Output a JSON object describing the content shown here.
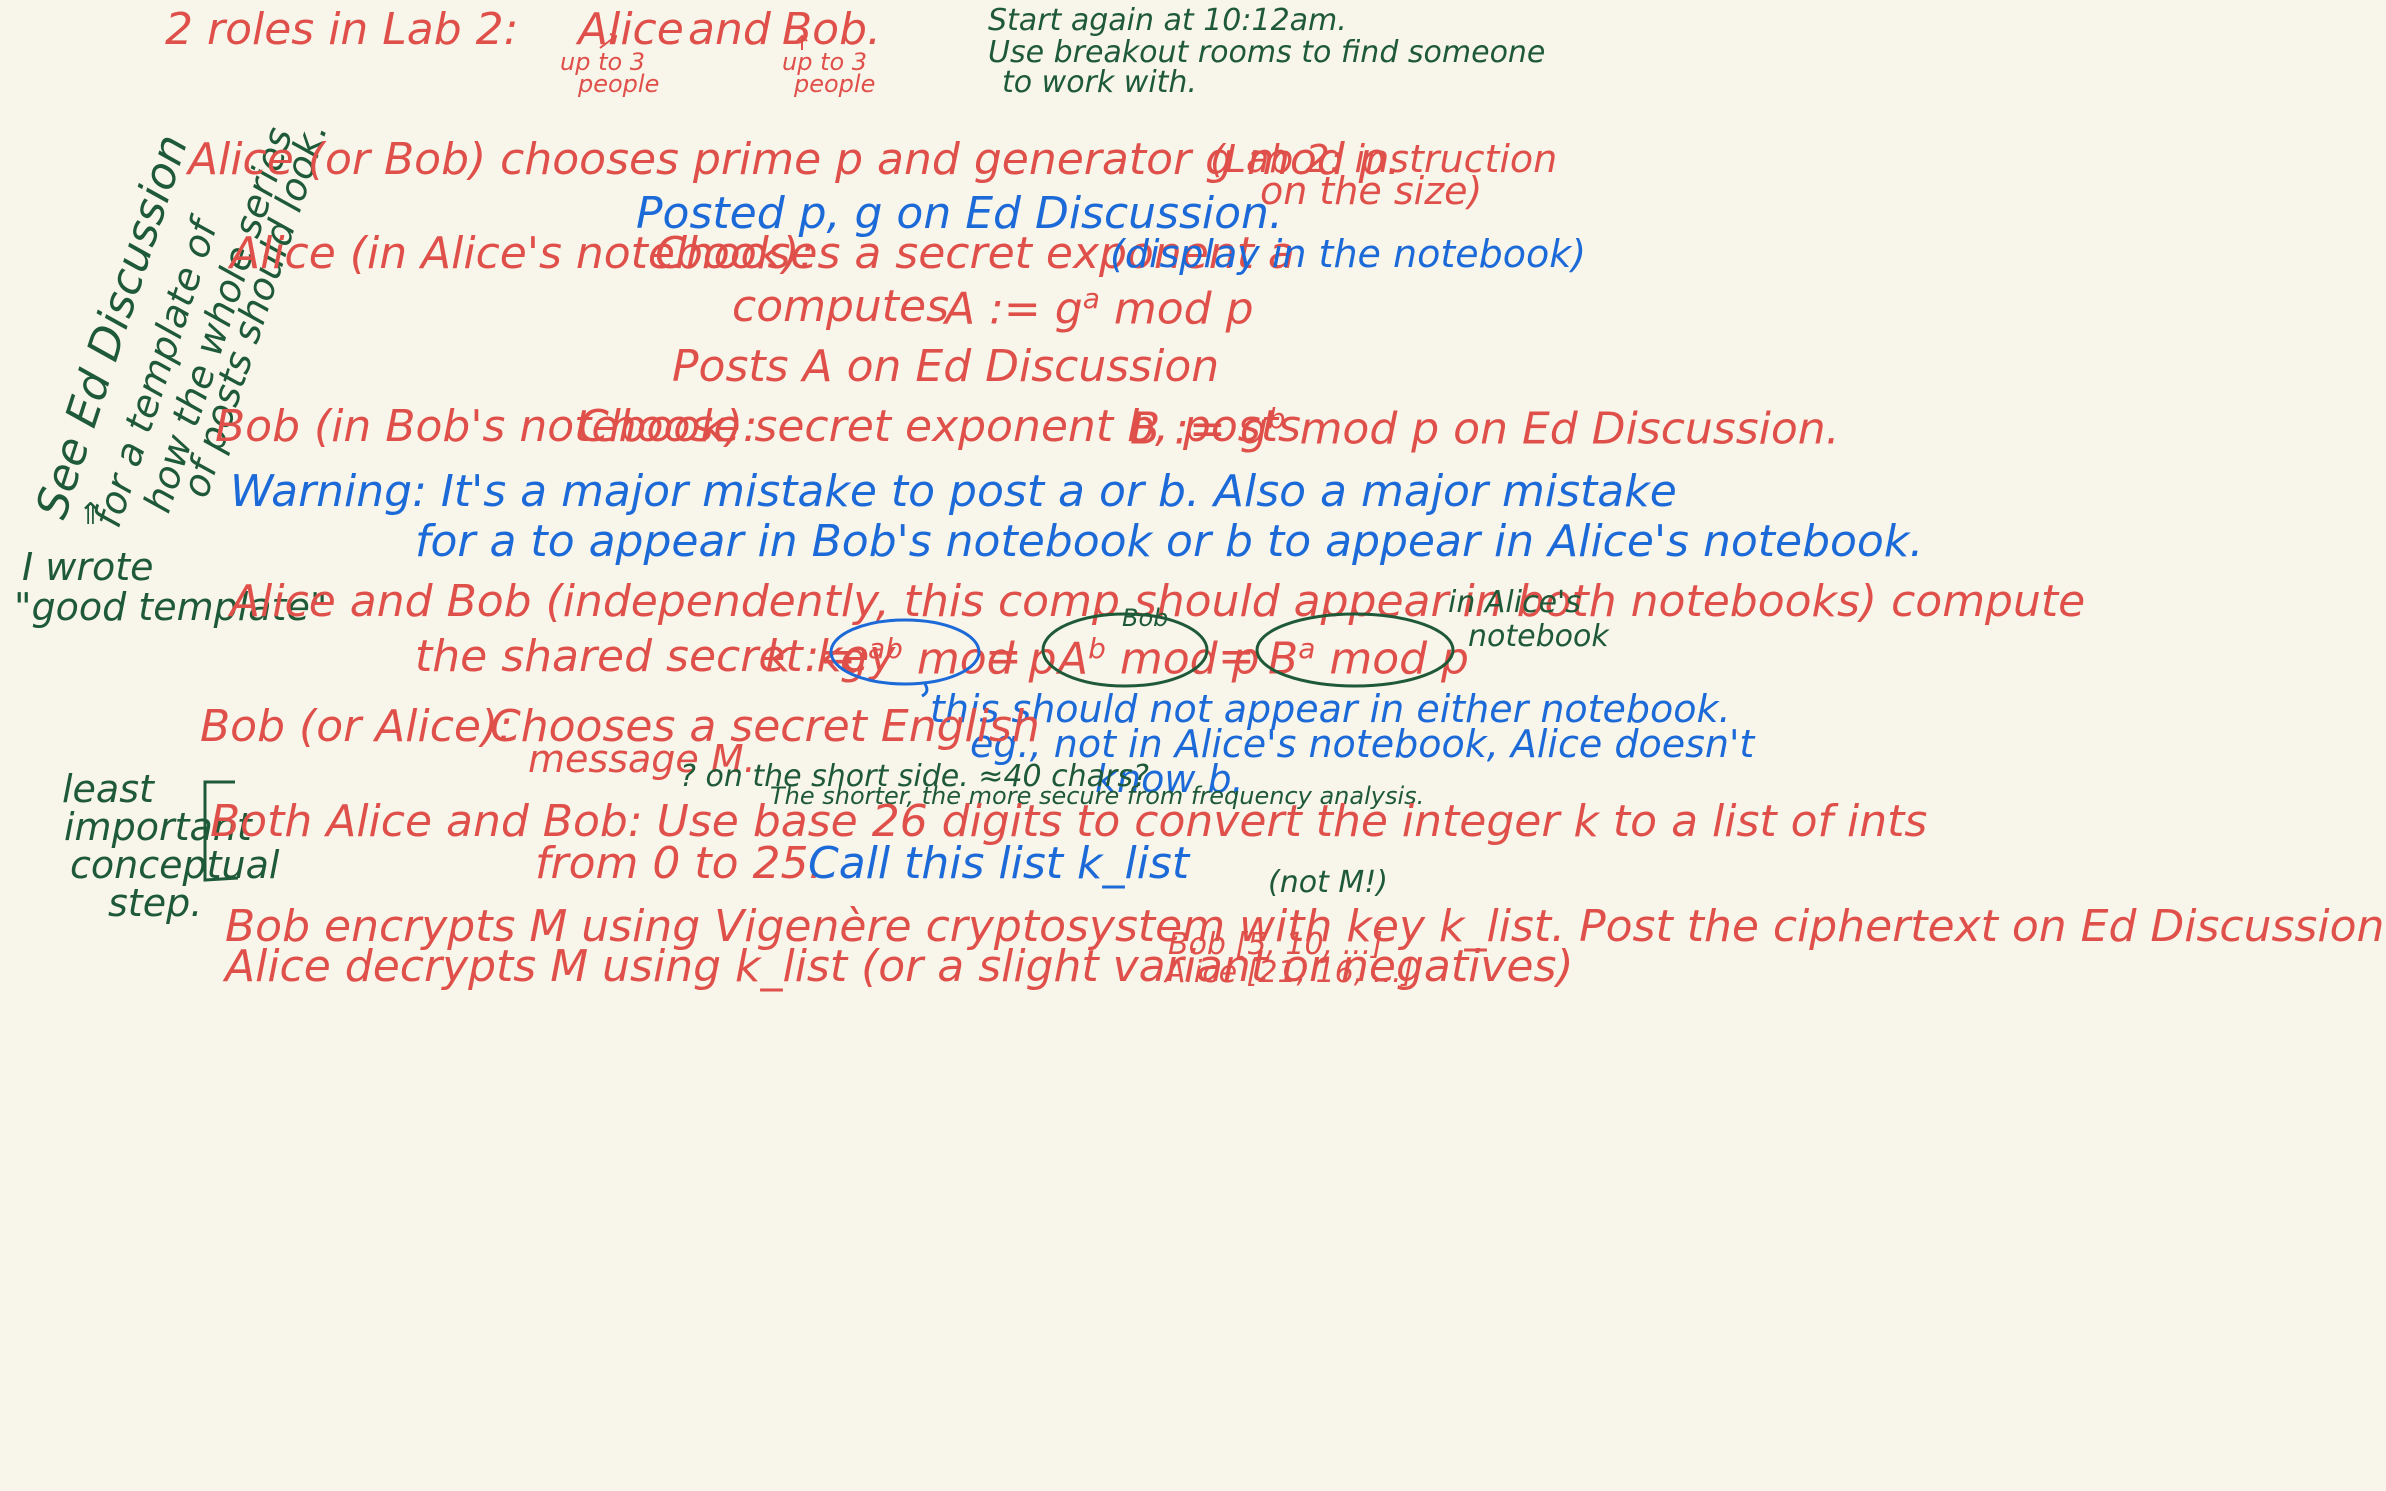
{
  "colors": {
    "background": "#f8f5eb",
    "red": "#e0504a",
    "blue": "#1c6ad8",
    "green": "#1f5a38"
  },
  "header": {
    "roles": "2 roles in Lab 2:",
    "alice": "Alice",
    "and": "and",
    "bob": "Bob.",
    "alice_note_1": "up to 3",
    "alice_note_2": "people",
    "bob_note_1": "up to 3",
    "bob_note_2": "people",
    "restart_1": "Start again at 10:12am.",
    "restart_2": "Use breakout rooms to find someone",
    "restart_3": "to work with."
  },
  "side": {
    "see_1": "See Ed Discussion",
    "see_2": "for a template of",
    "see_3": "how the whole series",
    "see_4": "of posts should look.",
    "wrote_1": "I wrote",
    "wrote_2": "\"good template\"",
    "least_1": "least",
    "least_2": "important",
    "least_3": "conceptual",
    "least_4": "step."
  },
  "steps": {
    "s1": "Alice (or Bob) chooses prime p and generator g mod p.",
    "s1_note_1": "(Lab 2: instruction",
    "s1_note_2": "on the size)",
    "s1_posted": "Posted p, g on Ed Discussion.",
    "s2_label": "Alice (in Alice's notebook):",
    "s2_text": "Chooses a secret exponent a",
    "s2_note": "(display in the notebook)",
    "s2_computes": "computes",
    "s2_formula": "A := g",
    "s2_sup": "a",
    "s2_formula_end": "mod p",
    "s2_posts": "Posts A on Ed Discussion",
    "s3_label": "Bob (in Bob's notebook):",
    "s3_text": "Choose secret exponent b, posts",
    "s3_formula": "B := g",
    "s3_sup": "b",
    "s3_formula_end": "mod p on Ed Discussion.",
    "warn_1": "Warning: It's a major mistake to post a or b.  Also a major mistake",
    "warn_2": "for a to appear in Bob's notebook or b to appear in Alice's notebook.",
    "s4_1": "Alice and Bob (independently, this comp should appear in both notebooks) compute",
    "s4_2": "the shared secret key",
    "s4_k": "k :=",
    "s4_g": "g",
    "s4_g_sup": "ab",
    "s4_g_end": "mod p",
    "s4_eq": "=",
    "s4_A": "A",
    "s4_A_sup": "b",
    "s4_A_end": "mod p",
    "s4_B": "B",
    "s4_B_sup": "a",
    "s4_B_end": "mod p",
    "s4_bob_label": "Bob",
    "s4_alice_label_1": "in Alice's",
    "s4_alice_label_2": "notebook",
    "s4_note_1": "this should not appear in either notebook.",
    "s4_note_2": "eg., not in Alice's notebook, Alice doesn't",
    "s4_note_3": "know b.",
    "s5_label": "Bob (or Alice):",
    "s5_text": "Chooses a secret English",
    "s5_text_2": "message M.",
    "s5_note_1": "? on the short side. ≈40 chars?",
    "s5_note_2": "The shorter, the more secure from frequency analysis.",
    "s6_1": "Both Alice and Bob: Use base 26 digits to convert the integer k to a list of ints",
    "s6_2a": "from 0 to 25.",
    "s6_2b": "Call this list k_list",
    "s7_note": "(not M!)",
    "s7_1": "Bob encrypts M using Vigenère cryptosystem with key k_list. Post the ciphertext on Ed Discussion",
    "s7_2": "Alice decrypts M using k_list (or a slight variant or negatives)",
    "s7_bob": "Bob [5, 10, ...]",
    "s7_alice": "Alice [21, 16, ...]"
  }
}
